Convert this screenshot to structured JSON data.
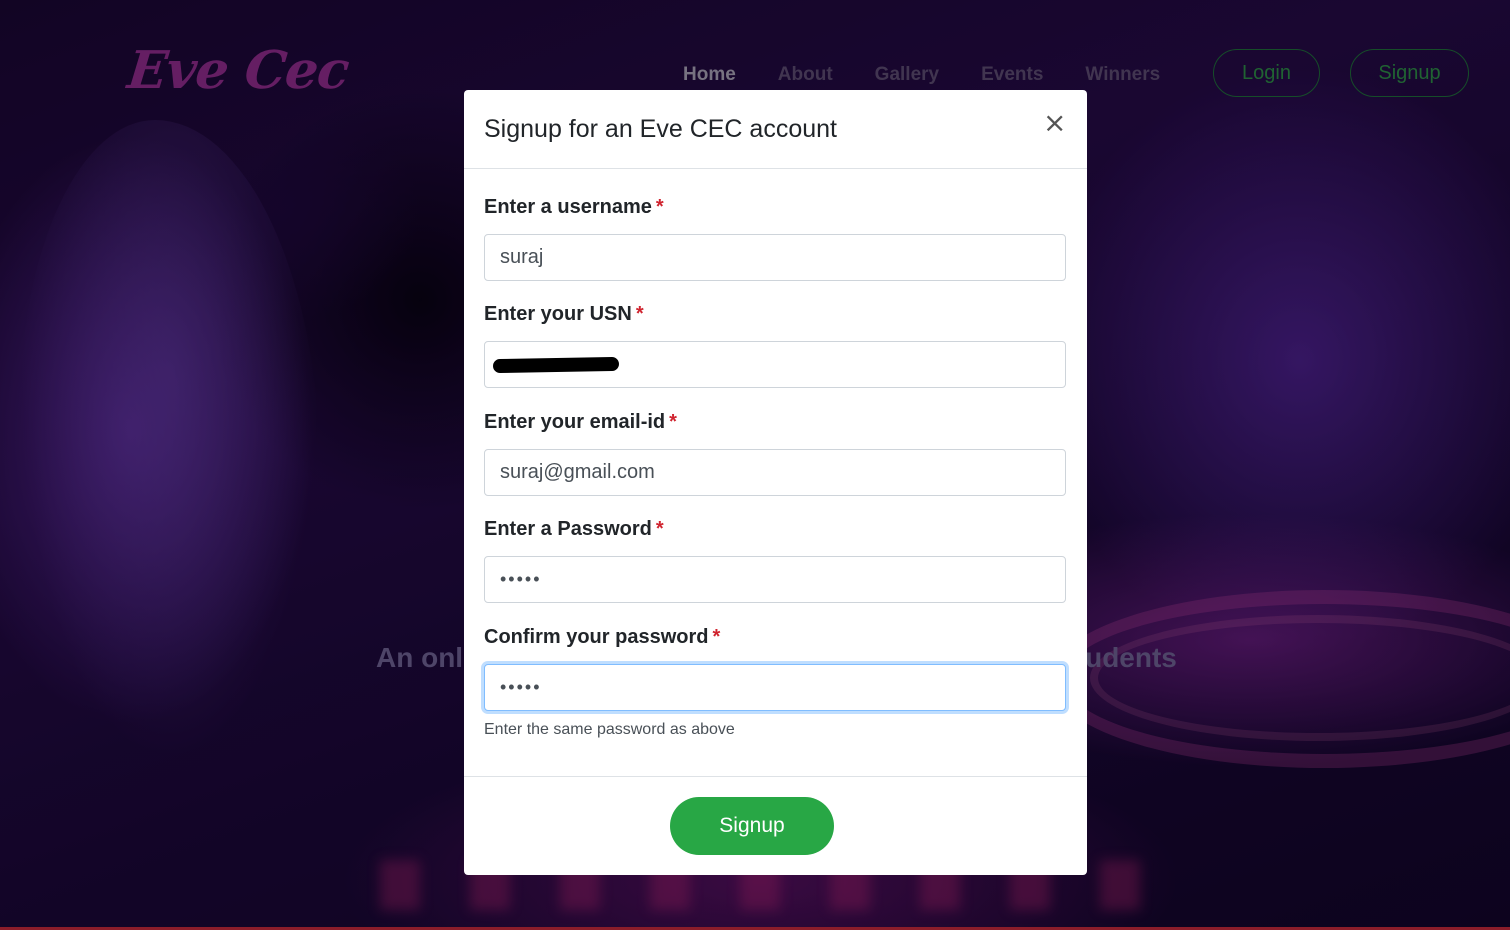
{
  "brand": {
    "logo_text": "Eve Cec",
    "logo_color": "#8c2a8a"
  },
  "nav": {
    "links": [
      {
        "label": "Home",
        "active": true
      },
      {
        "label": "About",
        "active": false
      },
      {
        "label": "Gallery",
        "active": false
      },
      {
        "label": "Events",
        "active": false
      },
      {
        "label": "Winners",
        "active": false
      }
    ],
    "login_label": "Login",
    "signup_label": "Signup"
  },
  "hero": {
    "tagline_left": "An onl",
    "tagline_right": "udents"
  },
  "modal": {
    "title": "Signup for an Eve CEC account",
    "close_symbol": "×",
    "fields": {
      "username": {
        "label": "Enter a username",
        "value": "suraj"
      },
      "usn": {
        "label": "Enter your USN",
        "value": ""
      },
      "email": {
        "label": "Enter your email-id",
        "value": "suraj@gmail.com"
      },
      "password": {
        "label": "Enter a Password",
        "value": "•••••"
      },
      "confirm": {
        "label": "Confirm your password",
        "value": "•••••",
        "help": "Enter the same password as above"
      }
    },
    "required_marker": "*",
    "submit_label": "Signup",
    "colors": {
      "primary_button": "#28a745",
      "required": "#d0242f",
      "focus_border": "#80bdff"
    }
  }
}
